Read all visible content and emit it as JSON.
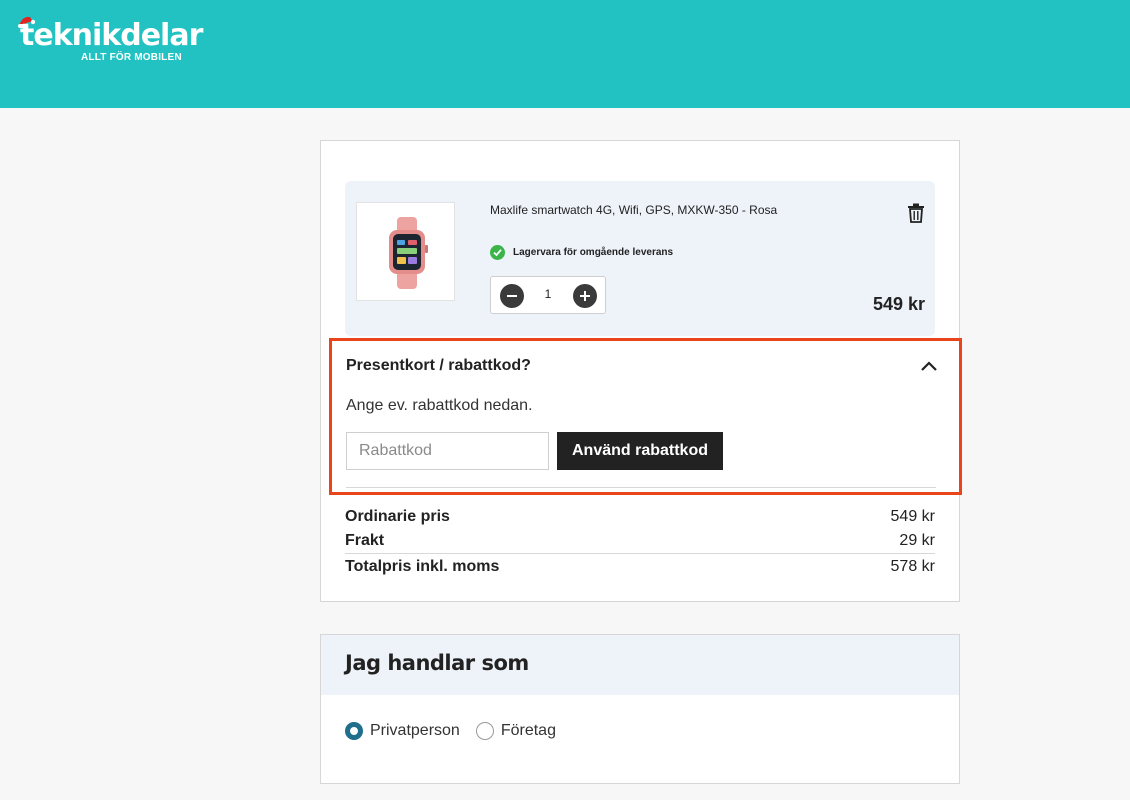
{
  "brand": {
    "name": "teknikdelar",
    "tagline": "ALLT FÖR MOBILEN",
    "header_color": "#22c2c2"
  },
  "cart": {
    "item": {
      "name": "Maxlife smartwatch 4G, Wifi, GPS, MXKW-350 - Rosa",
      "stock_status": "Lagervara för omgående leverans",
      "quantity": "1",
      "price": "549 kr",
      "image_icon": "smartwatch-image"
    },
    "coupon": {
      "title": "Presentkort / rabattkod?",
      "description": "Ange ev. rabattkod nedan.",
      "input_placeholder": "Rabattkod",
      "input_value": "",
      "button_label": "Använd rabattkod",
      "highlight_color": "#e8451b",
      "expanded": true
    },
    "totals": [
      {
        "label": "Ordinarie pris",
        "value": "549 kr"
      },
      {
        "label": "Frakt",
        "value": "29 kr"
      },
      {
        "label": "Totalpris inkl. moms",
        "value": "578 kr"
      }
    ]
  },
  "buyer": {
    "title": "Jag handlar som",
    "options": [
      {
        "label": "Privatperson",
        "selected": true
      },
      {
        "label": "Företag",
        "selected": false
      }
    ],
    "accent_color": "#1f6e8c"
  }
}
